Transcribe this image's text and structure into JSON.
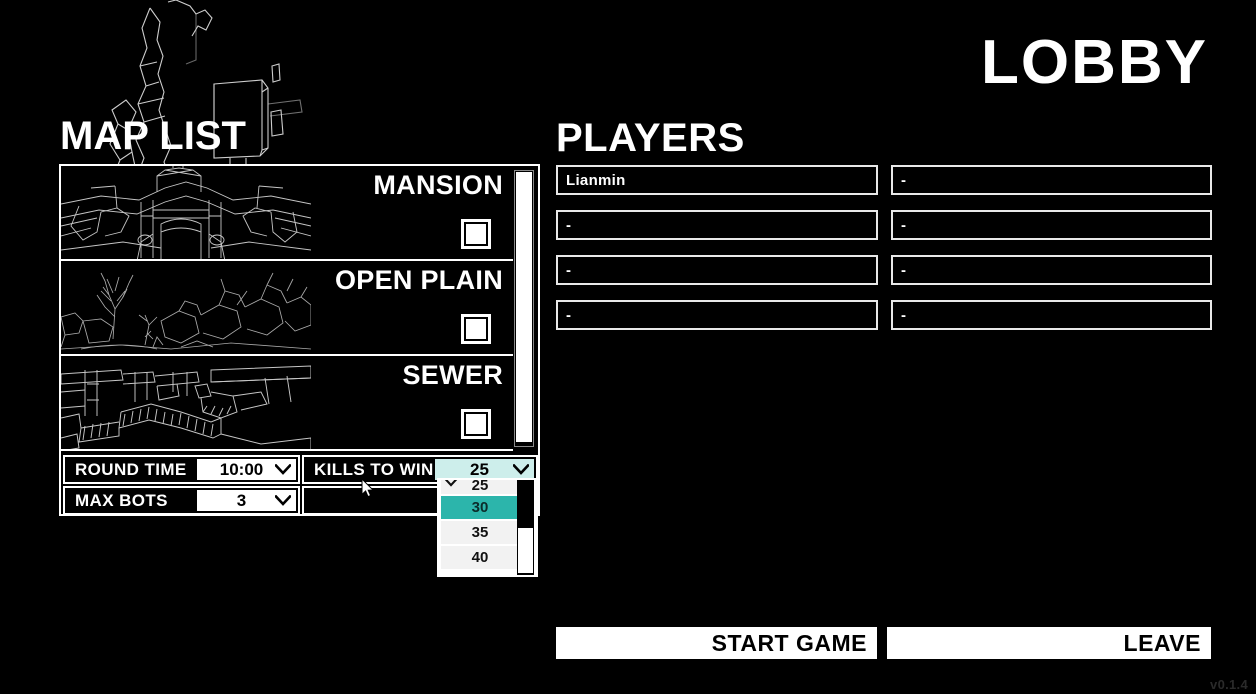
{
  "window": {
    "title": "LOBBY",
    "version": "v0.1.4"
  },
  "theme": {
    "background": "#000000",
    "foreground": "#ffffff",
    "accent_teal": "#2cb5ab",
    "accent_mint": "#cdeeeb",
    "dim_text": "#2a2a2a"
  },
  "map_list": {
    "title": "MAP LIST",
    "maps": [
      {
        "name": "MANSION",
        "checked": false,
        "thumbnail": "mansion-wireframe-thumbnail"
      },
      {
        "name": "OPEN PLAIN",
        "checked": false,
        "thumbnail": "open-plain-wireframe-thumbnail"
      },
      {
        "name": "SEWER",
        "checked": false,
        "thumbnail": "sewer-wireframe-thumbnail"
      }
    ],
    "scrollbar": {
      "name": "map-list-scrollbar"
    }
  },
  "settings": {
    "round_time": {
      "label": "ROUND TIME",
      "value": "10:00"
    },
    "max_bots": {
      "label": "MAX BOTS",
      "value": "3"
    },
    "kills_to_win": {
      "label": "KILLS TO WIN",
      "value": "25",
      "open": true,
      "options": [
        {
          "label": "25",
          "selected": false,
          "checked": true,
          "clipped": true
        },
        {
          "label": "30",
          "selected": true,
          "checked": false,
          "clipped": false
        },
        {
          "label": "35",
          "selected": false,
          "checked": false,
          "clipped": false
        },
        {
          "label": "40",
          "selected": false,
          "checked": false,
          "clipped": false
        }
      ]
    }
  },
  "players": {
    "title": "PLAYERS",
    "empty_slot": "-",
    "slots": [
      {
        "name": "Lianmin"
      },
      {
        "name": "-"
      },
      {
        "name": "-"
      },
      {
        "name": "-"
      },
      {
        "name": "-"
      },
      {
        "name": "-"
      },
      {
        "name": "-"
      },
      {
        "name": "-"
      }
    ]
  },
  "actions": {
    "start_game": "START GAME",
    "leave": "LEAVE"
  },
  "icons": {
    "chevron_down": "chevron-down-icon",
    "check": "check-icon",
    "cursor": "mouse-cursor-arrow"
  }
}
